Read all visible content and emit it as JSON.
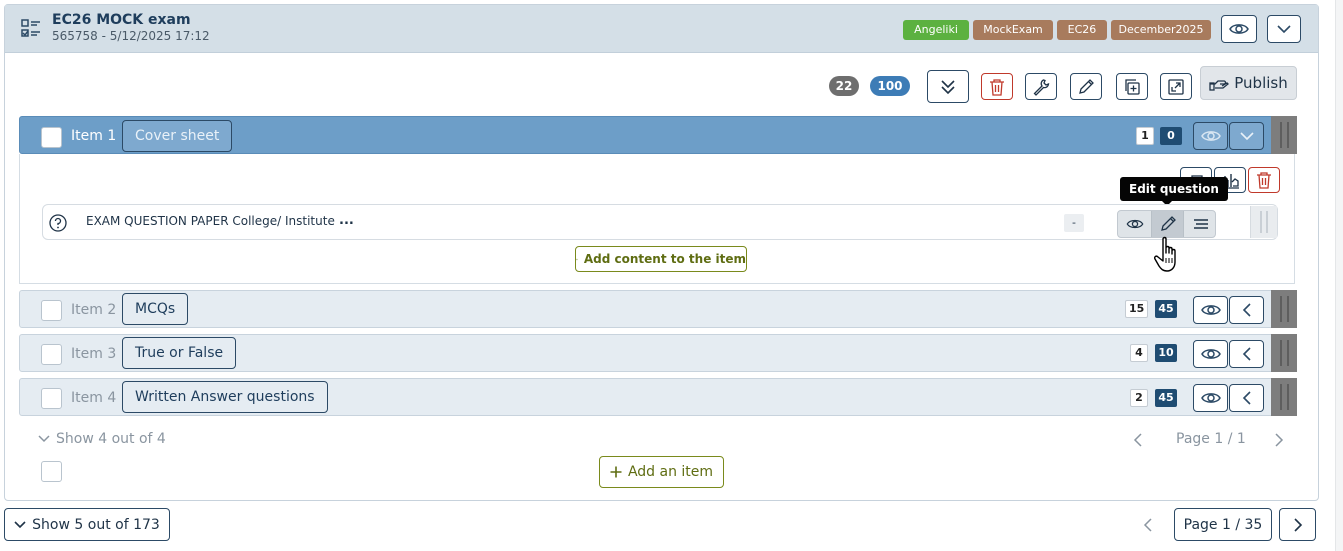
{
  "exam": {
    "title": "EC26 MOCK exam",
    "subtitle": "565758 - 5/12/2025 17:12",
    "tags": [
      {
        "label": "Angeliki",
        "color": "#5cb140"
      },
      {
        "label": "MockExam",
        "color": "#a87b5d"
      },
      {
        "label": "EC26",
        "color": "#a87b5d"
      },
      {
        "label": "December2025",
        "color": "#a87b5d"
      }
    ]
  },
  "toolbar": {
    "count_items": "22",
    "count_points": "100",
    "publish_label": "Publish"
  },
  "items": [
    {
      "num": "Item 1",
      "name": "Cover sheet",
      "count": "1",
      "points": "0"
    },
    {
      "num": "Item 2",
      "name": "MCQs",
      "count": "15",
      "points": "45"
    },
    {
      "num": "Item 3",
      "name": "True or False",
      "count": "4",
      "points": "10"
    },
    {
      "num": "Item 4",
      "name": "Written Answer questions",
      "count": "2",
      "points": "45"
    }
  ],
  "question": {
    "text": "EXAM QUESTION PAPER College/ Institute",
    "ellipsis": "...",
    "chip": "-",
    "tooltip": "Edit question"
  },
  "add_content_label": "Add content to the item",
  "items_footer": {
    "show_label": "Show 4 out of 4",
    "page_label": "Page 1 / 1",
    "add_item_label": "Add an item"
  },
  "page_footer": {
    "show_label": "Show 5 out of 173",
    "page_label": "Page 1 / 35"
  },
  "colors": {
    "accent_blue": "#6d9ec8",
    "navy": "#1f4c72",
    "olive": "#7a8a1c",
    "danger": "#c0392b"
  }
}
